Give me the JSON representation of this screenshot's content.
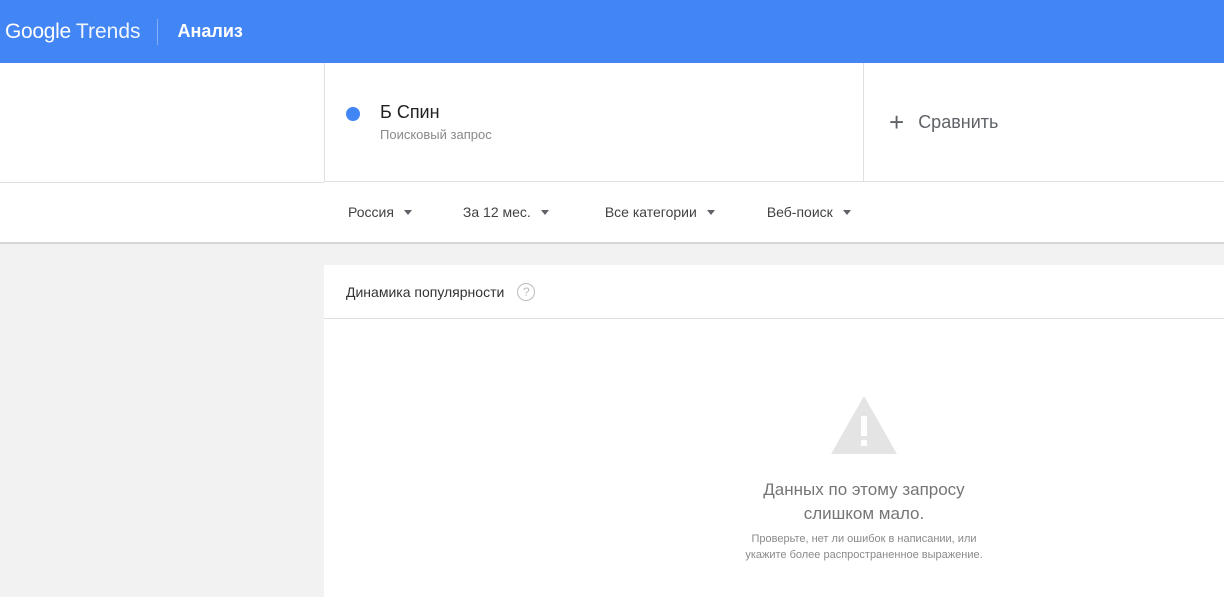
{
  "header": {
    "logo_google": "Google",
    "logo_trends": "Trends",
    "title": "Анализ"
  },
  "term": {
    "name": "Б Спин",
    "subtitle": "Поисковый запрос",
    "color": "#4285f4"
  },
  "compare": {
    "icon": "plus-icon",
    "label": "Сравнить"
  },
  "filters": [
    {
      "label": "Россия",
      "icon": "caret-down-icon"
    },
    {
      "label": "За 12 мес.",
      "icon": "caret-down-icon"
    },
    {
      "label": "Все категории",
      "icon": "caret-down-icon"
    },
    {
      "label": "Веб-поиск",
      "icon": "caret-down-icon"
    }
  ],
  "popularity_card": {
    "title": "Динамика популярности",
    "help_icon": "help-icon",
    "empty_icon": "warning-icon",
    "empty_title_line1": "Данных по этому запросу",
    "empty_title_line2": "слишком мало.",
    "empty_hint_line1": "Проверьте, нет ли ошибок в написании, или",
    "empty_hint_line2": "укажите более распространенное выражение."
  },
  "colors": {
    "brand_blue": "#4285f4",
    "page_background": "#f2f2f2"
  }
}
